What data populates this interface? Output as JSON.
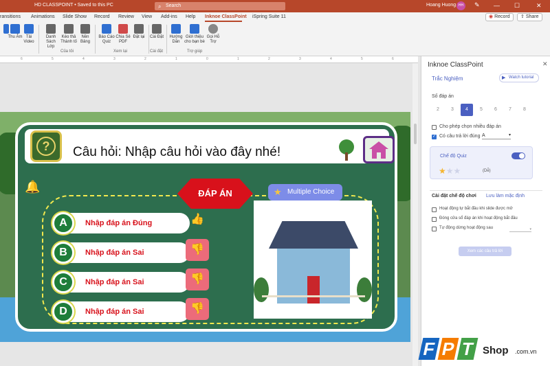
{
  "window": {
    "doc_title": "HD CLASSPOINT • Saved to this PC",
    "search_placeholder": "Search",
    "user_name": "Hoang Huong",
    "user_initials": "HH",
    "min": "—",
    "max": "☐",
    "close": "✕"
  },
  "tabs": {
    "items": [
      "ransitions",
      "Animations",
      "Slide Show",
      "Record",
      "Review",
      "View",
      "Add-ins",
      "Help",
      "Inknoe ClassPoint",
      "iSpring Suite 11"
    ],
    "record_label": "Record",
    "share_label": "Share"
  },
  "ribbon": {
    "buttons": [
      {
        "label": "Thu Âm",
        "color": "#2f6fd1"
      },
      {
        "label": "Tải Video",
        "color": "#2f6fd1"
      },
      {
        "label": "Danh Sách Lớp",
        "color": "#555555"
      },
      {
        "label": "Kéo thả Thành tố",
        "color": "#555555"
      },
      {
        "label": "Nền Bảng",
        "color": "#555555"
      },
      {
        "label": "Báo Cáo Quiz",
        "color": "#2f6fd1"
      },
      {
        "label": "Chia Sẻ PDF",
        "color": "#d04a4a"
      },
      {
        "label": "Đặt lại",
        "color": "#555555"
      },
      {
        "label": "Cài Đặt",
        "color": "#555555"
      },
      {
        "label": "Hướng Dẫn",
        "color": "#2f6fd1"
      },
      {
        "label": "Giới thiệu cho bạn bè",
        "color": "#2f6fd1"
      },
      {
        "label": "Gọi Hỗ Trợ",
        "color": "#555555"
      }
    ],
    "groups": [
      "Của tôi",
      "Xem lại",
      "Cài đặt",
      "Trợ giúp"
    ]
  },
  "ruler": [
    "6",
    "5",
    "4",
    "3",
    "2",
    "1",
    "0",
    "1",
    "2",
    "3",
    "4",
    "5",
    "6"
  ],
  "slide": {
    "question": "Câu hỏi: Nhập câu hỏi vào đây nhé!",
    "question_icon": "?",
    "answer_header": "ĐÁP ÁN",
    "mode_button": "Multiple Choice",
    "answers": [
      {
        "letter": "A",
        "text": "Nhập đáp án Đúng",
        "feedback": "thumbs-up-icon"
      },
      {
        "letter": "B",
        "text": "Nhập đáp án Sai",
        "feedback": "thumbs-down-icon"
      },
      {
        "letter": "C",
        "text": "Nhập đáp án Sai",
        "feedback": "thumbs-down-icon"
      },
      {
        "letter": "D",
        "text": "Nhập đáp án Sai",
        "feedback": "thumbs-down-icon"
      }
    ]
  },
  "pane": {
    "title": "Inknoe ClassPoint",
    "quiz_type": "Trắc Nghiệm",
    "watch_tutorial": "Watch tutorial",
    "num_answers_label": "Số đáp án",
    "answer_counts": [
      "2",
      "3",
      "4",
      "5",
      "6",
      "7",
      "8"
    ],
    "selected_count": "4",
    "allow_multiple": "Cho phép chọn nhiều đáp án",
    "has_correct": "Có câu trả lời đúng",
    "correct_value": "A",
    "quiz_mode": "Chế độ Quiz",
    "difficulty": "(Dễ)",
    "play_settings": "Cài đặt chế độ chơi",
    "save_default": "Lưu làm mặc định",
    "auto_start": "Hoạt động tự bắt đầu khi slide được mở",
    "close_submissions": "Đóng cửa sổ đáp án khi hoạt động bắt đầu",
    "auto_stop": "Tự động dừng hoạt động sau",
    "view_answers": "Xem các câu trả lời"
  },
  "brand": {
    "letters": [
      "F",
      "P",
      "T"
    ],
    "shop": "Shop",
    "domain": ".com.vn"
  }
}
